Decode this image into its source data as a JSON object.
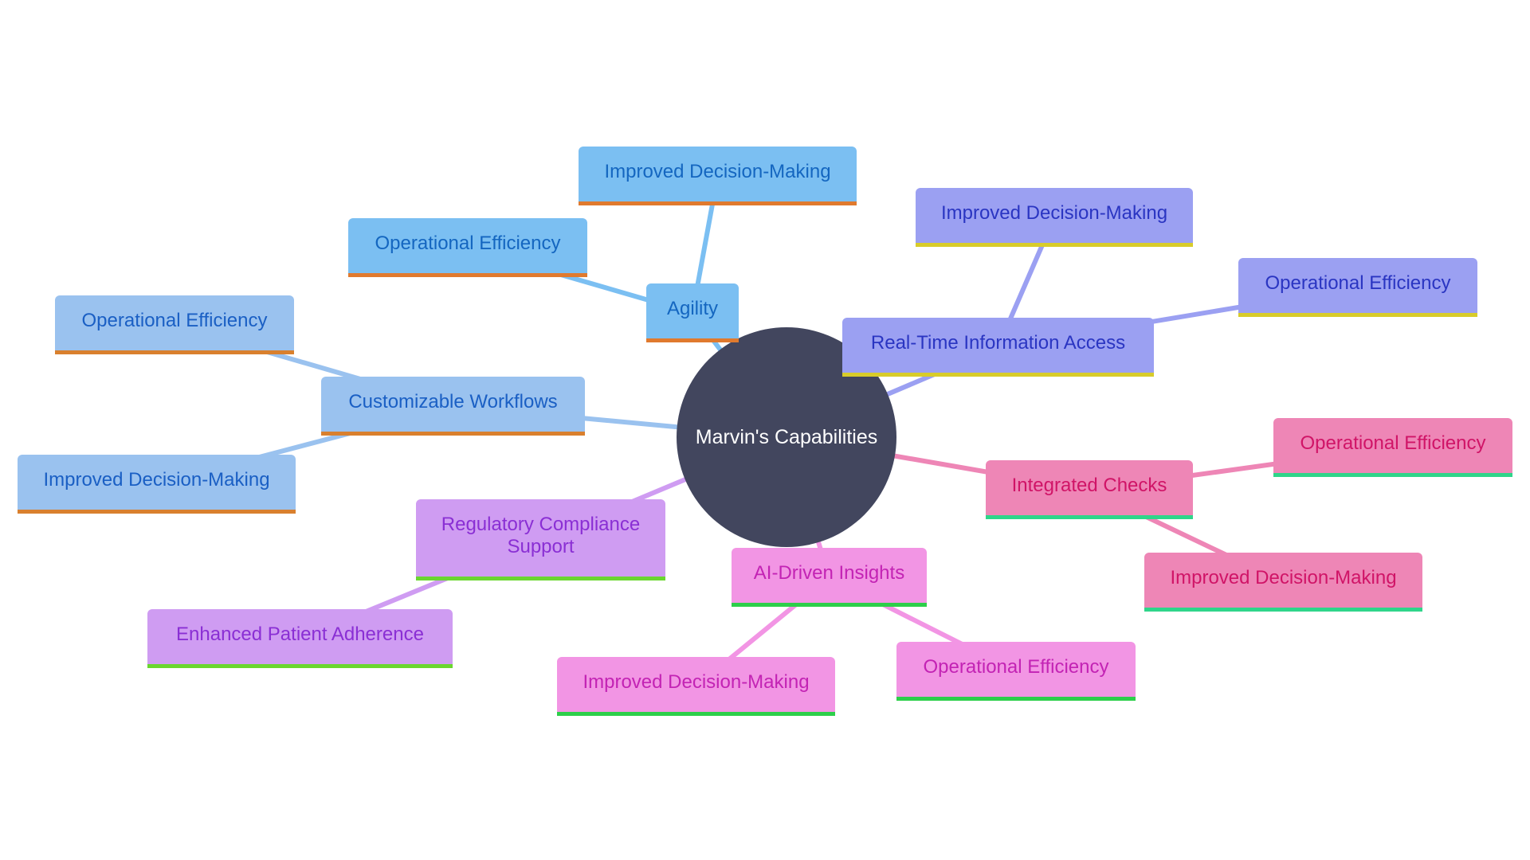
{
  "diagram": {
    "type": "mindmap",
    "root": {
      "label": "Marvin's Capabilities",
      "color": "#42465e",
      "text_color": "#ffffff"
    },
    "branches": [
      {
        "id": "agility",
        "label": "Agility",
        "theme": "c-blue",
        "edge_color": "#7bbff2",
        "children": [
          {
            "id": "agility-idm",
            "label": "Improved Decision-Making"
          },
          {
            "id": "agility-oe",
            "label": "Operational Efficiency"
          }
        ]
      },
      {
        "id": "cw",
        "label": "Customizable Workflows",
        "theme": "c-lblue",
        "edge_color": "#9ac2ef",
        "children": [
          {
            "id": "cw-oe",
            "label": "Operational Efficiency"
          },
          {
            "id": "cw-idm",
            "label": "Improved Decision-Making"
          }
        ]
      },
      {
        "id": "rcs",
        "label": "Regulatory Compliance Support",
        "theme": "c-purple",
        "edge_color": "#cf9cf2",
        "children": [
          {
            "id": "rcs-epa",
            "label": "Enhanced Patient Adherence"
          }
        ]
      },
      {
        "id": "ai",
        "label": "AI-Driven Insights",
        "theme": "c-magenta",
        "edge_color": "#f295e4",
        "children": [
          {
            "id": "ai-idm",
            "label": "Improved Decision-Making"
          },
          {
            "id": "ai-oe",
            "label": "Operational Efficiency"
          }
        ]
      },
      {
        "id": "rt",
        "label": "Real-Time Information Access",
        "theme": "c-violet",
        "edge_color": "#9ba0f2",
        "children": [
          {
            "id": "rt-idm",
            "label": "Improved Decision-Making"
          },
          {
            "id": "rt-oe",
            "label": "Operational Efficiency"
          }
        ]
      },
      {
        "id": "ic",
        "label": "Integrated Checks",
        "theme": "c-pink",
        "edge_color": "#ee86b6",
        "children": [
          {
            "id": "ic-oe",
            "label": "Operational Efficiency"
          },
          {
            "id": "ic-idm",
            "label": "Improved Decision-Making"
          }
        ]
      }
    ]
  }
}
